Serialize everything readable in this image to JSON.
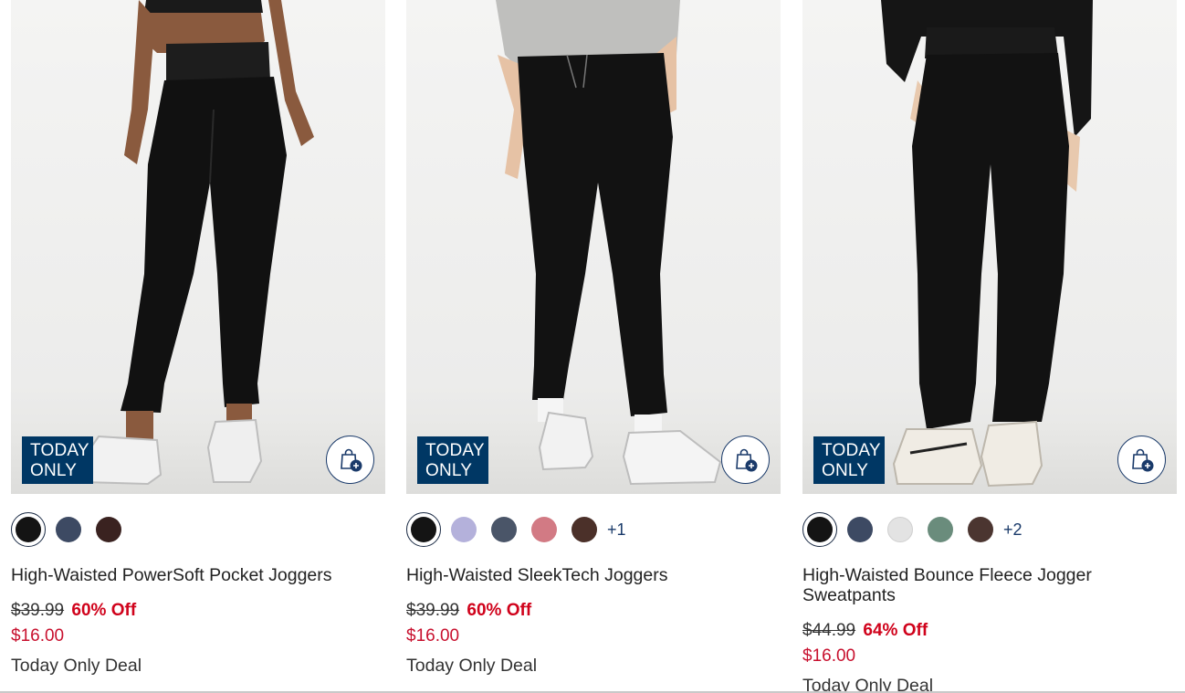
{
  "products": [
    {
      "badge_line1": "TODAY",
      "badge_line2": "ONLY",
      "swatch_colors": [
        "#141414",
        "#3d4a63",
        "#3a2220"
      ],
      "more_colors": "",
      "name": "High-Waisted PowerSoft Pocket Joggers",
      "original_price": "$39.99",
      "discount": "60% Off",
      "sale_price": "$16.00",
      "deal_label": "Today Only Deal"
    },
    {
      "badge_line1": "TODAY",
      "badge_line2": "ONLY",
      "swatch_colors": [
        "#141414",
        "#b4b1db",
        "#4a5568",
        "#d27a84",
        "#4b3029"
      ],
      "more_colors": "+1",
      "name": "High-Waisted SleekTech Joggers",
      "original_price": "$39.99",
      "discount": "60% Off",
      "sale_price": "$16.00",
      "deal_label": "Today Only Deal"
    },
    {
      "badge_line1": "TODAY",
      "badge_line2": "ONLY",
      "swatch_colors": [
        "#141414",
        "#3d4a63",
        "#e3e3e3",
        "#6a8c7c",
        "#4b3530"
      ],
      "more_colors": "+2",
      "name": "High-Waisted Bounce Fleece Jogger Sweatpants",
      "original_price": "$44.99",
      "discount": "64% Off",
      "sale_price": "$16.00",
      "deal_label": "Today Only Deal"
    }
  ],
  "colors": {
    "badge_bg": "#003764",
    "discount": "#d0021b",
    "sale_price": "#c8102e",
    "icon_navy": "#1a3a6a"
  },
  "icons": {
    "bag_button": "shopping-bag-plus-icon"
  }
}
